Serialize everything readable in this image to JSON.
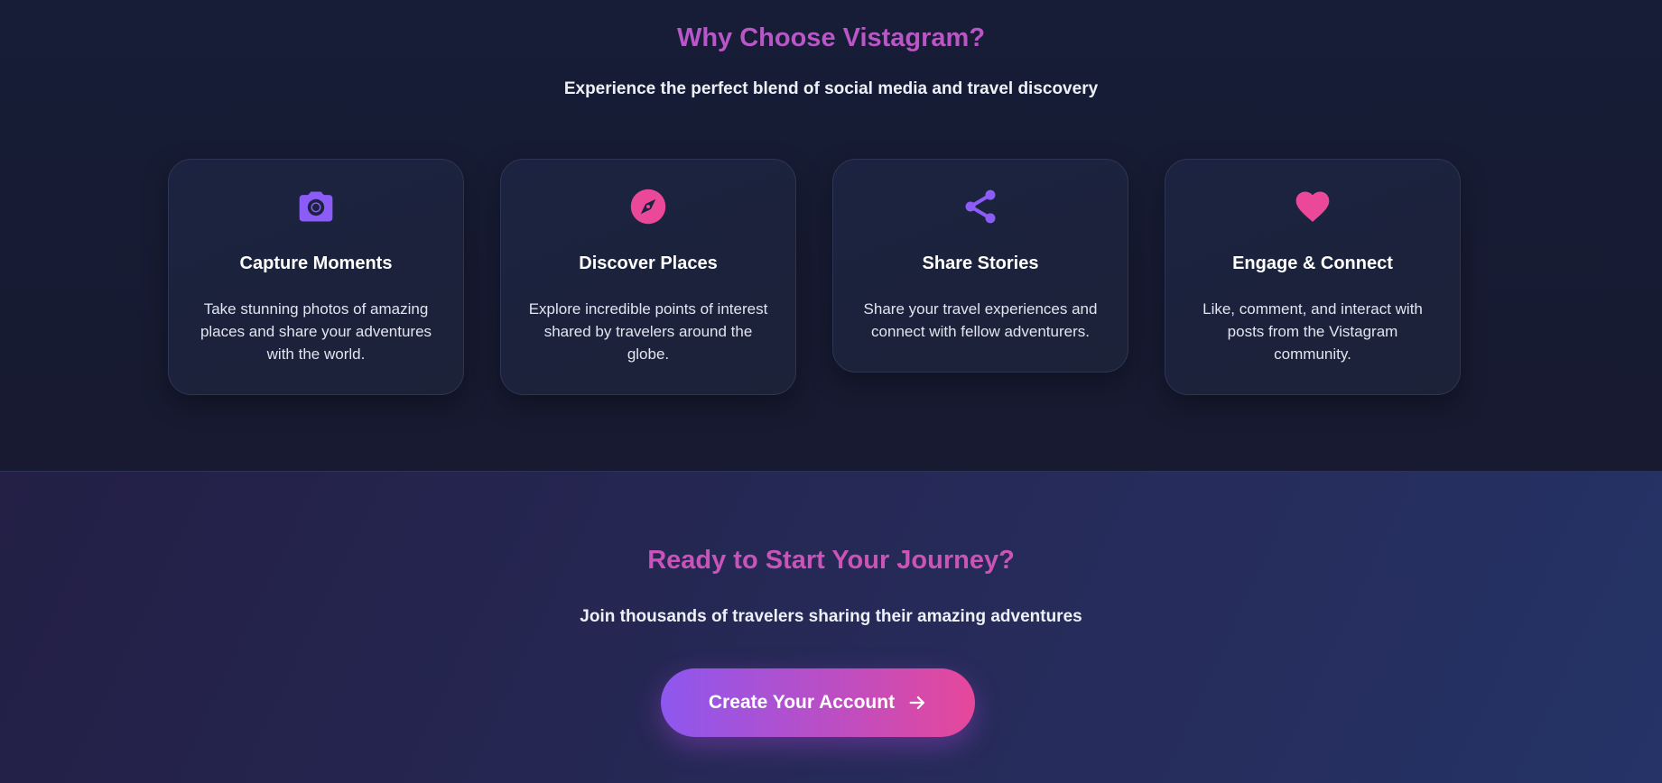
{
  "features": {
    "title": "Why Choose Vistagram?",
    "subtitle": "Experience the perfect blend of social media and travel discovery",
    "cards": [
      {
        "icon": "camera-icon",
        "title": "Capture Moments",
        "description": "Take stunning photos of amazing places and share your adventures with the world.",
        "icon_color": "#8b5cf6"
      },
      {
        "icon": "compass-icon",
        "title": "Discover Places",
        "description": "Explore incredible points of interest shared by travelers around the globe.",
        "icon_color": "#ec4899"
      },
      {
        "icon": "share-icon",
        "title": "Share Stories",
        "description": "Share your travel experiences and connect with fellow adventurers.",
        "icon_color": "#8b5cf6"
      },
      {
        "icon": "heart-icon",
        "title": "Engage & Connect",
        "description": "Like, comment, and interact with posts from the Vistagram community.",
        "icon_color": "#ec4899"
      }
    ]
  },
  "cta": {
    "title": "Ready to Start Your Journey?",
    "subtitle": "Join thousands of travelers sharing their amazing adventures",
    "button_label": "Create Your Account"
  },
  "colors": {
    "accent_purple": "#8b5cf6",
    "accent_pink": "#ec4899",
    "title_gradient_start": "#b35ad6",
    "background_dark": "#171d37"
  }
}
